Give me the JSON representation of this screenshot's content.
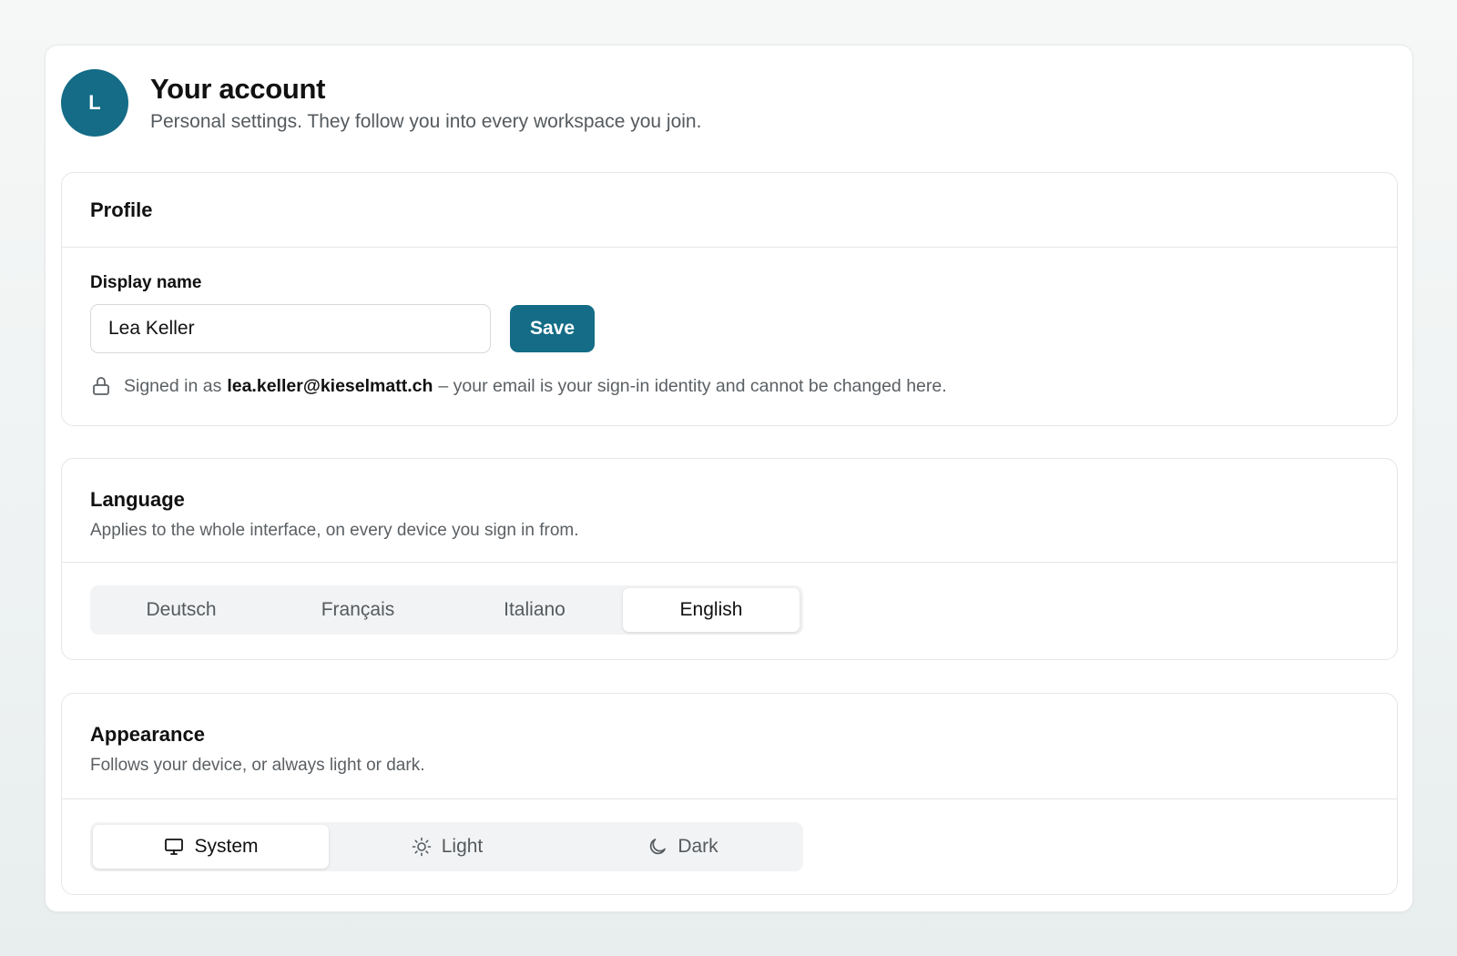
{
  "header": {
    "avatar_initial": "L",
    "title": "Your account",
    "subtitle": "Personal settings. They follow you into every workspace you join."
  },
  "profile": {
    "title": "Profile",
    "display_name_label": "Display name",
    "display_name_value": "Lea Keller",
    "save_label": "Save",
    "identity_prefix": "Signed in as",
    "email": "lea.keller@kieselmatt.ch",
    "identity_suffix": "– your email is your sign-in identity and cannot be changed here.",
    "lock_icon": "lock-icon"
  },
  "language": {
    "title": "Language",
    "description": "Applies to the whole interface, on every device you sign in from.",
    "options": [
      "Deutsch",
      "Français",
      "Italiano",
      "English"
    ],
    "selected": "English"
  },
  "appearance": {
    "title": "Appearance",
    "description": "Follows your device, or always light or dark.",
    "options": [
      {
        "label": "System",
        "icon": "monitor-icon"
      },
      {
        "label": "Light",
        "icon": "sun-icon"
      },
      {
        "label": "Dark",
        "icon": "moon-icon"
      }
    ],
    "selected": "System"
  },
  "colors": {
    "accent": "#146c86",
    "page_background": "#f2f5f5",
    "muted_text": "#5b6064"
  }
}
